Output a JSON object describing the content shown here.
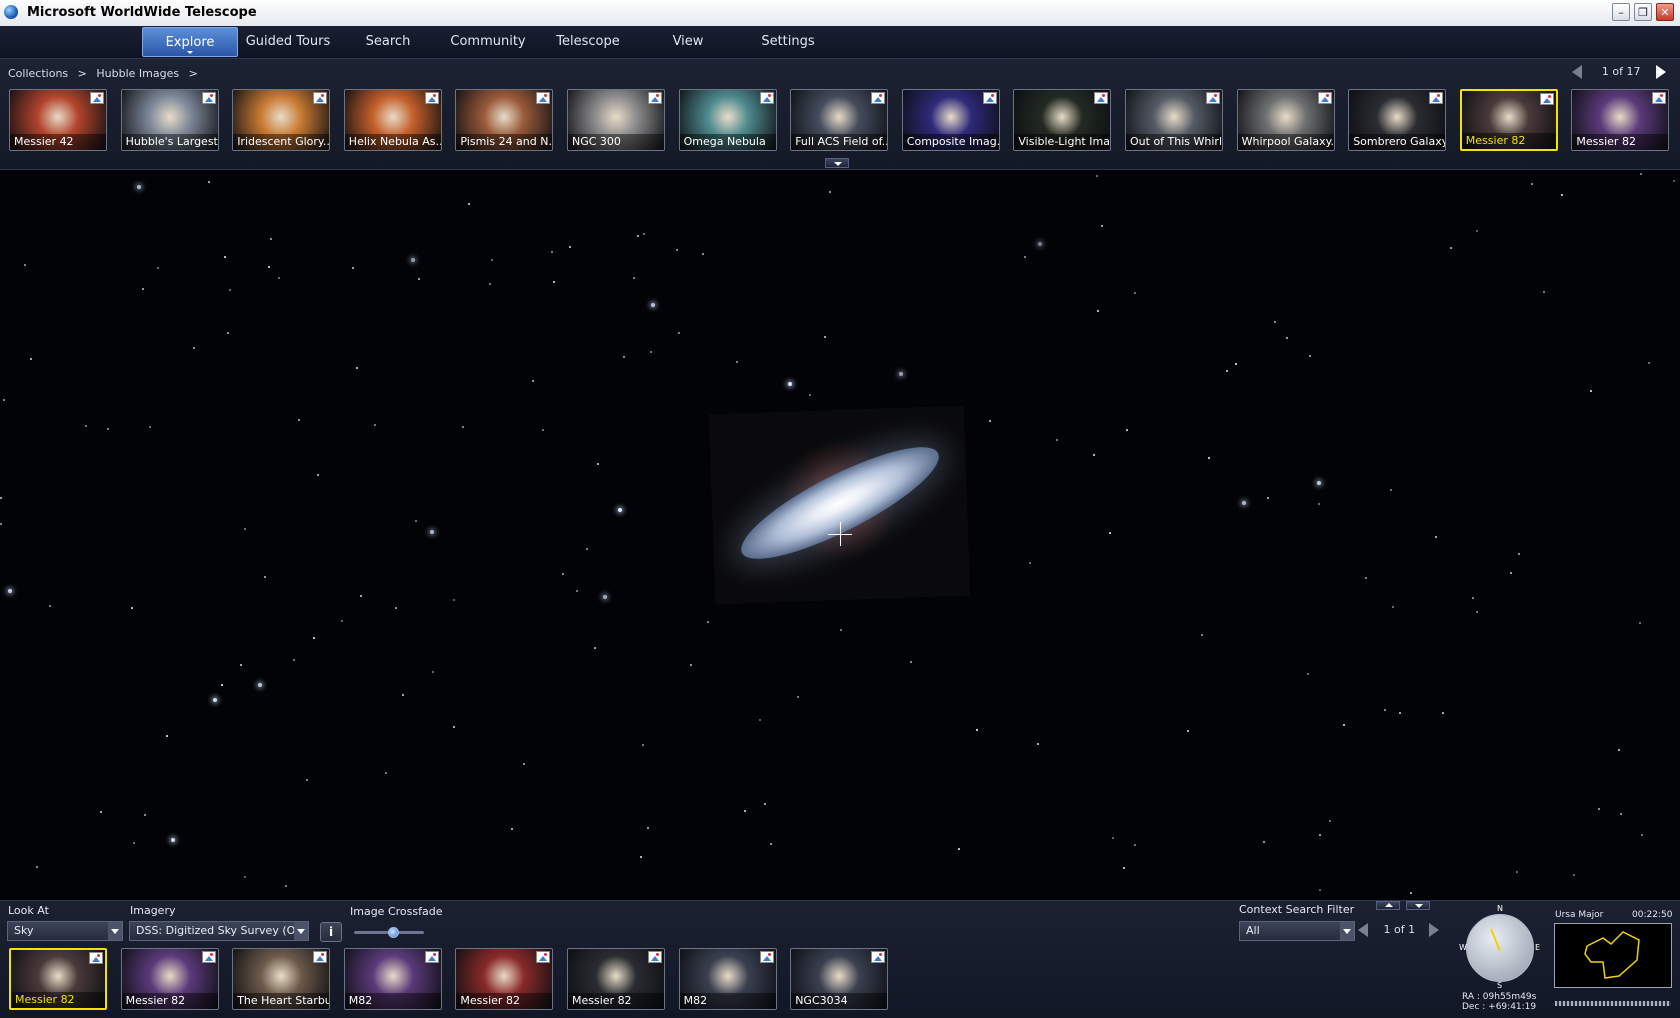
{
  "window": {
    "title": "Microsoft WorldWide Telescope",
    "controls": [
      "minimize-icon",
      "restore-icon",
      "close-icon"
    ]
  },
  "menu": {
    "tabs": [
      {
        "label": "Explore",
        "active": true
      },
      {
        "label": "Guided Tours"
      },
      {
        "label": "Search"
      },
      {
        "label": "Community"
      },
      {
        "label": "Telescope"
      },
      {
        "label": "View"
      },
      {
        "label": "Settings"
      }
    ]
  },
  "explore": {
    "breadcrumb": [
      "Collections",
      ">",
      "Hubble Images",
      ">"
    ],
    "pager": "1 of 17",
    "thumbnails": [
      {
        "caption": "Messier 42",
        "color": "#b3442c"
      },
      {
        "caption": "Hubble's Largest...",
        "color": "#7f8a9a"
      },
      {
        "caption": "Iridescent Glory...",
        "color": "#c97a33"
      },
      {
        "caption": "Helix Nebula As...",
        "color": "#c5602a"
      },
      {
        "caption": "Pismis 24 and N...",
        "color": "#9a5a3a"
      },
      {
        "caption": "NGC 300",
        "color": "#8e8e8e"
      },
      {
        "caption": "Omega Nebula",
        "color": "#4f8a8f"
      },
      {
        "caption": "Full ACS Field of...",
        "color": "#444c5c"
      },
      {
        "caption": "Composite Imag...",
        "color": "#2e2a7a"
      },
      {
        "caption": "Visible-Light Ima...",
        "color": "#232a22"
      },
      {
        "caption": "Out of This Whirl:...",
        "color": "#555c66"
      },
      {
        "caption": "Whirpool Galaxy...",
        "color": "#6d6f70"
      },
      {
        "caption": "Sombrero Galaxy",
        "color": "#2a2c31"
      },
      {
        "caption": "Messier 82",
        "color": "#4a3a3a",
        "selected": true
      },
      {
        "caption": "Messier 82",
        "color": "#5b3a7a"
      }
    ]
  },
  "bottom": {
    "look_at_label": "Look At",
    "look_at_value": "Sky",
    "imagery_label": "Imagery",
    "imagery_value": "DSS: Digitized Sky Survey (O...",
    "crossfade_label": "Image Crossfade",
    "crossfade_level": 0.55,
    "context_filter_label": "Context Search Filter",
    "context_filter_value": "All",
    "context_pager": "1 of 1",
    "thumbnails": [
      {
        "caption": "Messier 82",
        "color": "#4a3a3a",
        "selected": true
      },
      {
        "caption": "Messier 82",
        "color": "#5b3a7a"
      },
      {
        "caption": "The Heart Starbu...",
        "color": "#6d5a4a"
      },
      {
        "caption": "M82",
        "color": "#5b3a7a"
      },
      {
        "caption": "Messier 82",
        "color": "#8a2a2a"
      },
      {
        "caption": "Messier 82",
        "color": "#2a2c31"
      },
      {
        "caption": "M82",
        "color": "#3a4050"
      },
      {
        "caption": "NGC3034",
        "color": "#3a4050"
      }
    ],
    "compass": {
      "n": "N",
      "s": "S",
      "e": "E",
      "w": "W"
    },
    "ra": "RA : 09h55m49s",
    "dec": "Dec : +69:41:19",
    "constellation": "Ursa Major",
    "time": "00:22:50"
  }
}
